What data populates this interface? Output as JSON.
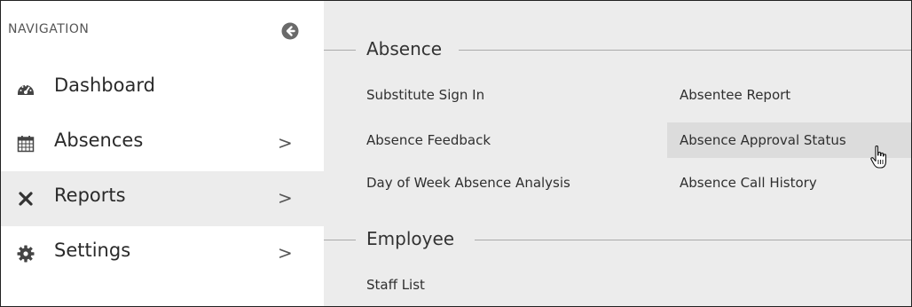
{
  "sidebar": {
    "title": "NAVIGATION",
    "collapse_icon": "circle-arrow-left-icon",
    "items": [
      {
        "label": "Dashboard",
        "icon": "dashboard-icon",
        "has_submenu": false,
        "active": false
      },
      {
        "label": "Absences",
        "icon": "calendar-icon",
        "has_submenu": true,
        "active": false
      },
      {
        "label": "Reports",
        "icon": "close-x-icon",
        "has_submenu": true,
        "active": true
      },
      {
        "label": "Settings",
        "icon": "gear-icon",
        "has_submenu": true,
        "active": false
      }
    ],
    "chevron": ">"
  },
  "main": {
    "sections": [
      {
        "title": "Absence",
        "links": [
          "Substitute Sign In",
          "Absentee Report",
          "Absence Feedback",
          "Absence Approval Status",
          "Day of Week Absence Analysis",
          "Absence Call History"
        ],
        "hovered": "Absence Approval Status"
      },
      {
        "title": "Employee",
        "links": [
          "Staff List"
        ]
      }
    ]
  },
  "colors": {
    "sidebar_bg": "#ffffff",
    "active_bg": "#ececec",
    "main_bg": "#ececec",
    "hover_bg": "#dcdcdc"
  },
  "cursor": "hand-pointer-icon"
}
